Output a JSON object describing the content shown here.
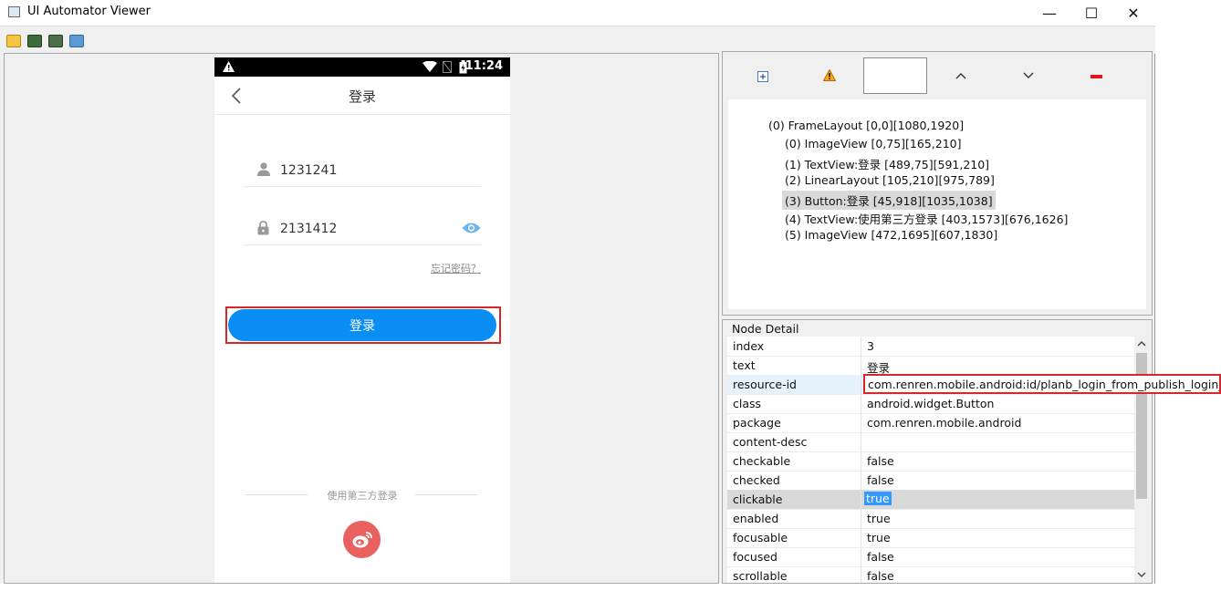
{
  "window": {
    "title": "UI Automator Viewer",
    "min_glyph": "—",
    "max_glyph": "☐",
    "close_glyph": "✕"
  },
  "phone": {
    "status_time": "11:24",
    "header_title": "登录",
    "username_value": "1231241",
    "password_value": "2131412",
    "forgot_password": "忘记密码？",
    "login_button": "登录",
    "third_party_label": "使用第三方登录"
  },
  "tree": {
    "root": "(0) FrameLayout [0,0][1080,1920]",
    "children": [
      "(0) ImageView [0,75][165,210]",
      "(1) TextView:登录 [489,75][591,210]",
      "(2) LinearLayout [105,210][975,789]",
      "(3) Button:登录 [45,918][1035,1038]",
      "(4) TextView:使用第三方登录 [403,1573][676,1626]",
      "(5) ImageView [472,1695][607,1830]"
    ],
    "selected_index": 3
  },
  "detail": {
    "title": "Node Detail",
    "rows": [
      {
        "k": "index",
        "v": "3"
      },
      {
        "k": "text",
        "v": "登录"
      },
      {
        "k": "resource-id",
        "v": ""
      },
      {
        "k": "class",
        "v": "android.widget.Button"
      },
      {
        "k": "package",
        "v": "com.renren.mobile.android"
      },
      {
        "k": "content-desc",
        "v": ""
      },
      {
        "k": "checkable",
        "v": "false"
      },
      {
        "k": "checked",
        "v": "false"
      },
      {
        "k": "clickable",
        "v": "true"
      },
      {
        "k": "enabled",
        "v": "true"
      },
      {
        "k": "focusable",
        "v": "true"
      },
      {
        "k": "focused",
        "v": "false"
      },
      {
        "k": "scrollable",
        "v": "false"
      }
    ],
    "resource_id_popup": "com.renren.mobile.android:id/planb_login_from_publish_login_btn"
  },
  "colors": {
    "accent_blue": "#0a8ef3",
    "highlight_red": "#d9262b",
    "weibo_red": "#e8615f"
  }
}
